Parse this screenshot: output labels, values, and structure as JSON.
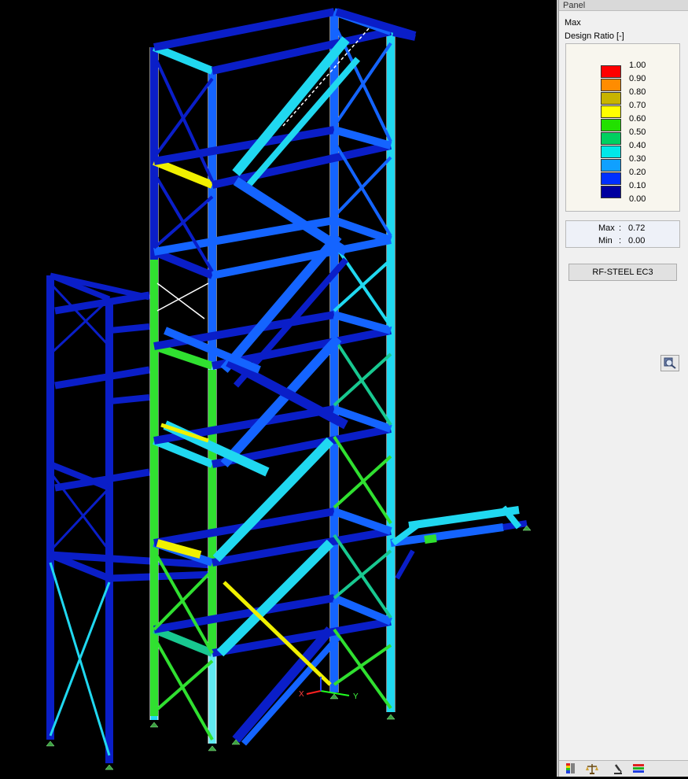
{
  "panel": {
    "title": "Panel",
    "heading": "Max",
    "subheading": "Design Ratio [-]",
    "legend": [
      {
        "value": "1.00",
        "color": "#ff0000"
      },
      {
        "value": "0.90",
        "color": "#ff8c00"
      },
      {
        "value": "0.80",
        "color": "#c8b400"
      },
      {
        "value": "0.70",
        "color": "#ffff00"
      },
      {
        "value": "0.60",
        "color": "#22e000"
      },
      {
        "value": "0.50",
        "color": "#00d060"
      },
      {
        "value": "0.40",
        "color": "#00e8e8"
      },
      {
        "value": "0.30",
        "color": "#10a0ff"
      },
      {
        "value": "0.20",
        "color": "#0030ff"
      },
      {
        "value": "0.10",
        "color": "#0000a0"
      },
      {
        "value": "0.00",
        "color": null
      }
    ],
    "max_label": "Max",
    "max_value": "0.72",
    "min_label": "Min",
    "min_value": "0.00",
    "module_button": "RF-STEEL EC3"
  },
  "axes": {
    "x": "X",
    "y": "Y"
  },
  "toolbar_icons": [
    "color-scale-icon",
    "scale-balance-icon",
    "microscope-icon",
    "bars-icon"
  ],
  "colors": {
    "dark_blue": "#0a1ec8",
    "mid_blue": "#1464ff",
    "cyan": "#20d8f0",
    "light_cyan": "#60e8f0",
    "green": "#30e030",
    "teal_green": "#18c890",
    "yellow": "#f0f000",
    "background": "#000000"
  }
}
